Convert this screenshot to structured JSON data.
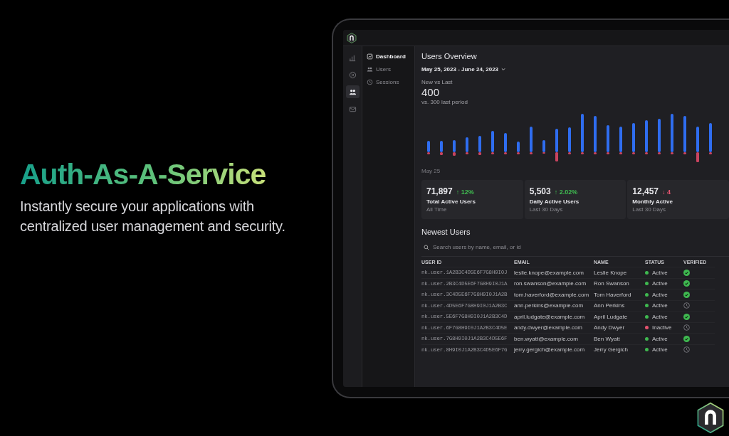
{
  "hero": {
    "title": "Auth-As-A-Service",
    "subtitle": "Instantly secure your applications with centralized user management and security."
  },
  "rail": {
    "items": [
      {
        "kind": "chart",
        "selected": false
      },
      {
        "kind": "blocked",
        "selected": false
      },
      {
        "kind": "users",
        "selected": true
      },
      {
        "kind": "mail",
        "selected": false
      }
    ]
  },
  "sidebar": {
    "items": [
      {
        "kind": "dashboard",
        "label": "Dashboard",
        "selected": true
      },
      {
        "kind": "users",
        "label": "Users",
        "selected": false
      },
      {
        "kind": "sessions",
        "label": "Sessions",
        "selected": false
      }
    ]
  },
  "overview": {
    "title": "Users Overview",
    "date_range": "May 25, 2023 - June 24, 2023",
    "metric_label": "New vs Last",
    "metric_value": "400",
    "metric_comparison": "vs. 300 last period",
    "chart_start_label": "May 25"
  },
  "stats": [
    {
      "value": "71,897",
      "change": "↑ 12%",
      "color": "#3fb950",
      "label": "Total Active Users",
      "period": "All Time"
    },
    {
      "value": "5,503",
      "change": "↑ 2.02%",
      "color": "#3fb950",
      "label": "Daily Active Users",
      "period": "Last 30 Days"
    },
    {
      "value": "12,457",
      "change": "↓ 4",
      "color": "#e5536f",
      "label": "Monthly Active",
      "period": "Last 30 Days"
    }
  ],
  "newest_users": {
    "title": "Newest Users",
    "search_placeholder": "Search users by name, email, or id",
    "columns": [
      "USER ID",
      "EMAIL",
      "NAME",
      "STATUS",
      "VERIFIED"
    ],
    "rows": [
      {
        "user_id": "nk.user.1A2B3C4D5E6F7G8H9I0J",
        "email": "leslie.knope@example.com",
        "name": "Leslie Knope",
        "status": "Active",
        "color": "#3fb950",
        "verified": true
      },
      {
        "user_id": "nk.user.2B3C4D5E6F7G8H9I0J1A",
        "email": "ron.swanson@example.com",
        "name": "Ron Swanson",
        "status": "Active",
        "color": "#3fb950",
        "verified": true
      },
      {
        "user_id": "nk.user.3C4D5E6F7G8H9I0J1A2B",
        "email": "tom.haverford@example.com",
        "name": "Tom Haverford",
        "status": "Active",
        "color": "#3fb950",
        "verified": true
      },
      {
        "user_id": "nk.user.4D5E6F7G8H9I0J1A2B3C",
        "email": "ann.perkins@example.com",
        "name": "Ann Perkins",
        "status": "Active",
        "color": "#3fb950",
        "verified": false
      },
      {
        "user_id": "nk.user.5E6F7G8H9I0J1A2B3C4D",
        "email": "april.ludgate@example.com",
        "name": "April Ludgate",
        "status": "Active",
        "color": "#3fb950",
        "verified": true
      },
      {
        "user_id": "nk.user.6F7G8H9I0J1A2B3C4D5E",
        "email": "andy.dwyer@example.com",
        "name": "Andy Dwyer",
        "status": "Inactive",
        "color": "#e5536f",
        "verified": false
      },
      {
        "user_id": "nk.user.7G8H9I0J1A2B3C4D5E6F",
        "email": "ben.wyatt@example.com",
        "name": "Ben Wyatt",
        "status": "Active",
        "color": "#3fb950",
        "verified": true
      },
      {
        "user_id": "nk.user.8H9I0J1A2B3C4D5E6F7G",
        "email": "jerry.gergich@example.com",
        "name": "Jerry Gergich",
        "status": "Active",
        "color": "#3fb950",
        "verified": false
      }
    ]
  }
}
